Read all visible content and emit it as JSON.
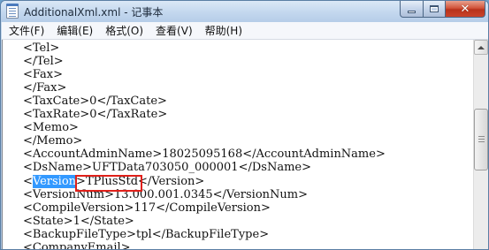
{
  "window": {
    "title": "AdditionalXml.xml - 记事本",
    "close_glyph": "✕"
  },
  "menu": [
    {
      "label": "文件(F)"
    },
    {
      "label": "编辑(E)"
    },
    {
      "label": "格式(O)"
    },
    {
      "label": "查看(V)"
    },
    {
      "label": "帮助(H)"
    }
  ],
  "editor": {
    "lines": [
      "<Tel>",
      "</Tel>",
      "<Fax>",
      "</Fax>",
      "<TaxCate>0</TaxCate>",
      "<TaxRate>0</TaxRate>",
      "<Memo>",
      "</Memo>",
      "<AccountAdminName>18025095168</AccountAdminName>",
      "<DsName>UFTData703050_000001</DsName>",
      "",
      "<VersionNum>13.000.001.0345</VersionNum>",
      "<CompileVersion>117</CompileVersion>",
      "<State>1</State>",
      "<BackupFileType>tpl</BackupFileType>",
      "<CompanyEmail>"
    ],
    "version_line": {
      "open_bracket": "<",
      "selected": "Version",
      "rest": ">TPlusStd</Version>"
    }
  },
  "colors": {
    "selection": "#3399ff",
    "highlight_box": "#e0201a"
  },
  "icons": {
    "app": "notepad-icon",
    "minimize": "minimize-icon",
    "maximize": "maximize-icon",
    "close": "close-icon",
    "scroll_up": "chevron-up-icon"
  }
}
